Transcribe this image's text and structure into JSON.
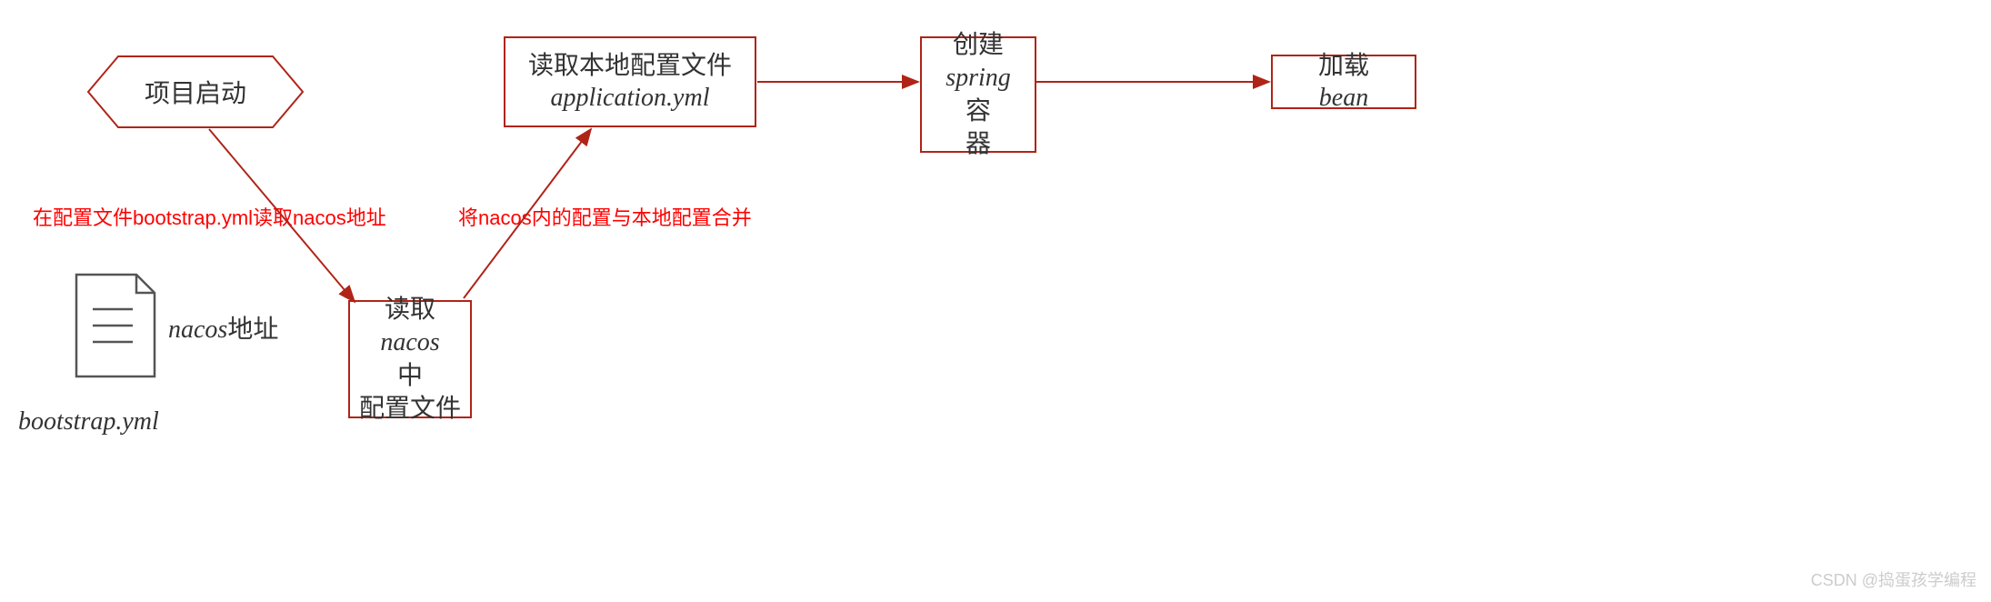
{
  "nodes": {
    "start": {
      "text": "项目启动"
    },
    "readNacos": {
      "line1": "读取",
      "line2": "nacos",
      "line2_suffix": "中",
      "line3": "配置文件"
    },
    "readLocal": {
      "line1": "读取本地配置文件",
      "line2": "application.yml"
    },
    "spring": {
      "line1": "创建",
      "line2pre": "spring",
      "line2suf": "容",
      "line3": "器"
    },
    "loadBean": {
      "text_pre": "加载",
      "text_italic": "bean"
    }
  },
  "annotations": {
    "left": "在配置文件bootstrap.yml读取nacos地址",
    "right": "将nacos内的配置与本地配置合并"
  },
  "docLabel": {
    "pre": "nacos",
    "suf": "地址"
  },
  "fileLabel": "bootstrap.yml",
  "watermark": "CSDN @捣蛋孩学编程",
  "colors": {
    "border": "#b02418",
    "red": "#ff0000"
  }
}
